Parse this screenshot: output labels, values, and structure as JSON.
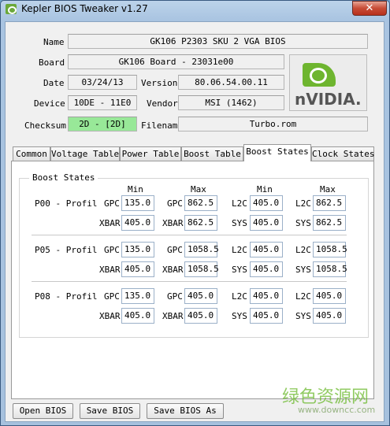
{
  "window": {
    "title": "Kepler BIOS Tweaker v1.27",
    "close": "✕"
  },
  "info": {
    "name_label": "Name",
    "name_value": "GK106 P2303 SKU 2 VGA BIOS",
    "board_label": "Board",
    "board_value": "GK106 Board - 23031e00",
    "date_label": "Date",
    "date_value": "03/24/13",
    "version_label": "Version",
    "version_value": "80.06.54.00.11",
    "device_label": "Device",
    "device_value": "10DE - 11E0",
    "vendor_label": "Vendor",
    "vendor_value": "MSI (1462)",
    "checksum_label": "Checksum",
    "checksum_value": "2D - [2D]",
    "filename_label": "Filenam",
    "filename_value": "Turbo.rom"
  },
  "logo": {
    "text": "nVIDIA.",
    "icon": "nvidia-eye-icon"
  },
  "tabs": [
    "Common",
    "Voltage Table",
    "Power Table",
    "Boost Table",
    "Boost States",
    "Clock States"
  ],
  "active_tab": "Boost States",
  "boost": {
    "group_title": "Boost States",
    "headers": [
      "Min",
      "Max",
      "Min",
      "Max"
    ],
    "profiles": [
      {
        "label": "P00 - Profil",
        "row1": {
          "l1": "GPC",
          "v1": "135.0",
          "l2": "GPC",
          "v2": "862.5",
          "l3": "L2C",
          "v3": "405.0",
          "l4": "L2C",
          "v4": "862.5"
        },
        "row2": {
          "l1": "XBAR",
          "v1": "405.0",
          "l2": "XBAR",
          "v2": "862.5",
          "l3": "SYS",
          "v3": "405.0",
          "l4": "SYS",
          "v4": "862.5"
        }
      },
      {
        "label": "P05 - Profil",
        "row1": {
          "l1": "GPC",
          "v1": "135.0",
          "l2": "GPC",
          "v2": "1058.5",
          "l3": "L2C",
          "v3": "405.0",
          "l4": "L2C",
          "v4": "1058.5"
        },
        "row2": {
          "l1": "XBAR",
          "v1": "405.0",
          "l2": "XBAR",
          "v2": "1058.5",
          "l3": "SYS",
          "v3": "405.0",
          "l4": "SYS",
          "v4": "1058.5"
        }
      },
      {
        "label": "P08 - Profil",
        "row1": {
          "l1": "GPC",
          "v1": "135.0",
          "l2": "GPC",
          "v2": "405.0",
          "l3": "L2C",
          "v3": "405.0",
          "l4": "L2C",
          "v4": "405.0"
        },
        "row2": {
          "l1": "XBAR",
          "v1": "405.0",
          "l2": "XBAR",
          "v2": "405.0",
          "l3": "SYS",
          "v3": "405.0",
          "l4": "SYS",
          "v4": "405.0"
        }
      }
    ]
  },
  "buttons": {
    "open": "Open BIOS",
    "save": "Save BIOS",
    "save_as": "Save BIOS As"
  },
  "watermark": {
    "cn": "绿色资源网",
    "url": "www.downcc.com"
  },
  "colors": {
    "checksum_ok": "#98e898",
    "nvidia_green": "#6eb52f"
  }
}
